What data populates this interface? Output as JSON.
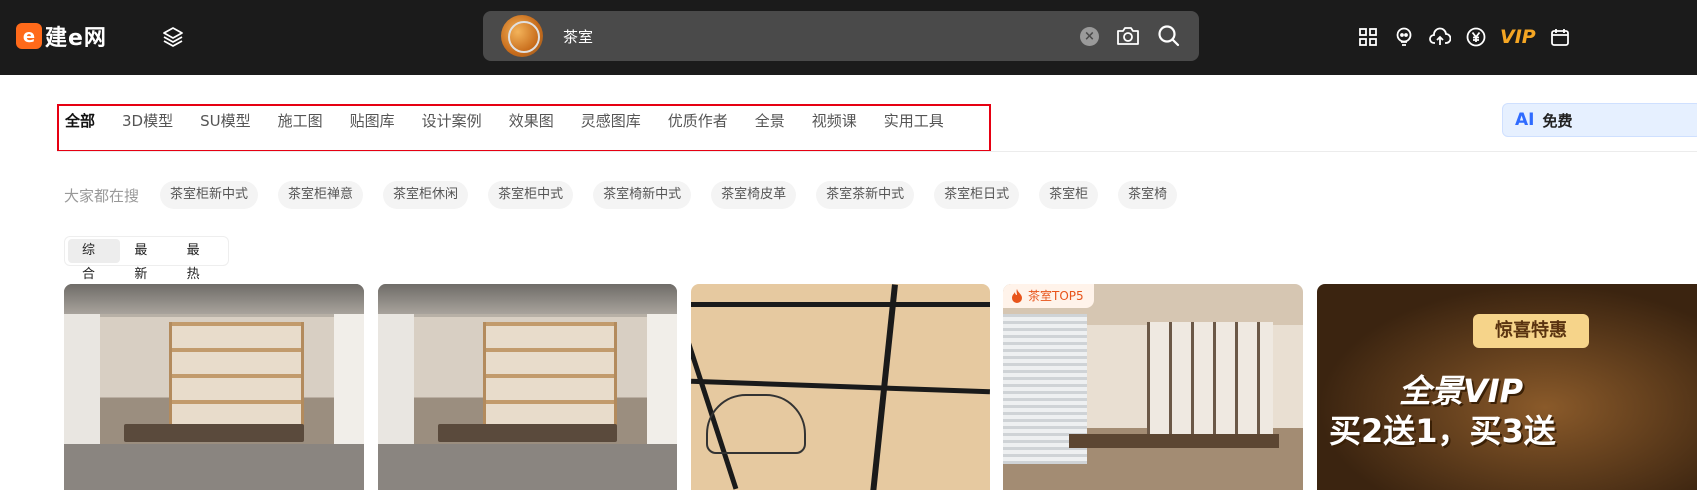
{
  "header": {
    "logo_mark": "e",
    "logo_text": "建e网",
    "search": {
      "value": "茶室",
      "clear_symbol": "×"
    },
    "vip_label": "VIP"
  },
  "categories": [
    {
      "label": "全部",
      "active": true
    },
    {
      "label": "3D模型"
    },
    {
      "label": "SU模型"
    },
    {
      "label": "施工图"
    },
    {
      "label": "贴图库"
    },
    {
      "label": "设计案例"
    },
    {
      "label": "效果图"
    },
    {
      "label": "灵感图库"
    },
    {
      "label": "优质作者"
    },
    {
      "label": "全景"
    },
    {
      "label": "视频课"
    },
    {
      "label": "实用工具"
    }
  ],
  "ai_button": {
    "badge": "AI",
    "label": "免费"
  },
  "hot_searches": {
    "label": "大家都在搜",
    "items": [
      "茶室柜新中式",
      "茶室柜禅意",
      "茶室柜休闲",
      "茶室柜中式",
      "茶室椅新中式",
      "茶室椅皮革",
      "茶室茶新中式",
      "茶室柜日式",
      "茶室柜",
      "茶室椅"
    ]
  },
  "sort": {
    "items": [
      "综合",
      "最新",
      "最热"
    ],
    "active": "综合"
  },
  "cards": {
    "badge_text": "茶室TOP5",
    "promo_tag": "惊喜特惠",
    "promo_line1": "全景VIP",
    "promo_line2": "买2送1，买3送"
  },
  "colors": {
    "header_bg": "#1b1b1b",
    "highlight": "#e60012",
    "vip": "#f5a623",
    "accent_orange": "#ff6a1a"
  }
}
